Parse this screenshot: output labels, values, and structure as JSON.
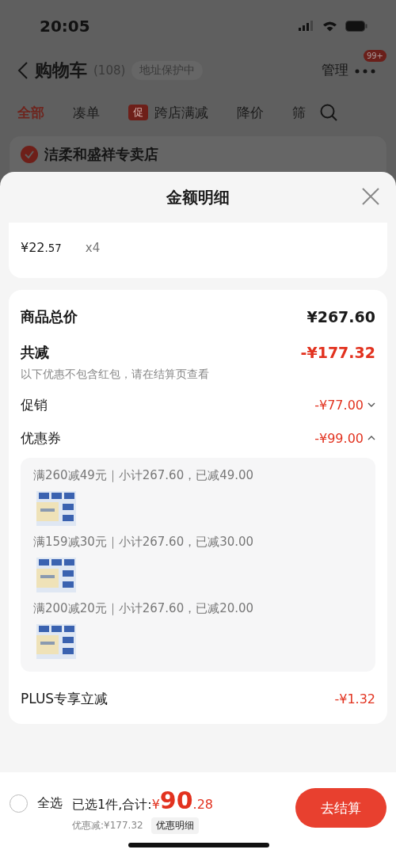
{
  "status_bar": {
    "time": "20:05"
  },
  "nav": {
    "title": "购物车",
    "count": "(108)",
    "address_badge": "地址保护中",
    "manage": "管理",
    "more_badge": "99+"
  },
  "tabs": [
    {
      "label": "全部",
      "selected": true
    },
    {
      "label": "凑单",
      "selected": false
    },
    {
      "label": "跨店满减",
      "selected": false,
      "tag": "促"
    },
    {
      "label": "降价",
      "selected": false
    },
    {
      "label": "筛",
      "selected": false
    }
  ],
  "shop": {
    "name": "洁柔和盛祥专卖店",
    "checked": true
  },
  "sheet": {
    "title": "金额明细",
    "item": {
      "price": "¥22",
      "price_decimals": ".57",
      "quantity": "x4"
    },
    "rows": [
      {
        "kind": "total",
        "label": "商品总价",
        "amount": "¥267.60"
      },
      {
        "kind": "reduction",
        "label": "共减",
        "amount": "-¥177.32",
        "note": "以下优惠不包含红包，请在结算页查看"
      },
      {
        "kind": "discount",
        "label": "促销",
        "amount": "-¥77.00",
        "expanded": false
      },
      {
        "kind": "discount",
        "label": "优惠券",
        "amount": "-¥99.00",
        "expanded": true,
        "coupons": [
          {
            "text": "满260减49元｜小计267.60，已减49.00"
          },
          {
            "text": "满159减30元｜小计267.60，已减30.00"
          },
          {
            "text": "满200减20元｜小计267.60，已减20.00"
          }
        ]
      },
      {
        "kind": "plus",
        "label": "PLUS专享立减",
        "amount": "-¥1.32"
      }
    ]
  },
  "bottom_bar": {
    "select_all": {
      "label": "全选",
      "checked": false
    },
    "summary": "已选1件,合计:",
    "currency": "¥",
    "total": "90",
    "total_decimals": ".28",
    "discount": "优惠减:¥177.32",
    "detail_button": "优惠明细",
    "checkout": "去结算"
  }
}
